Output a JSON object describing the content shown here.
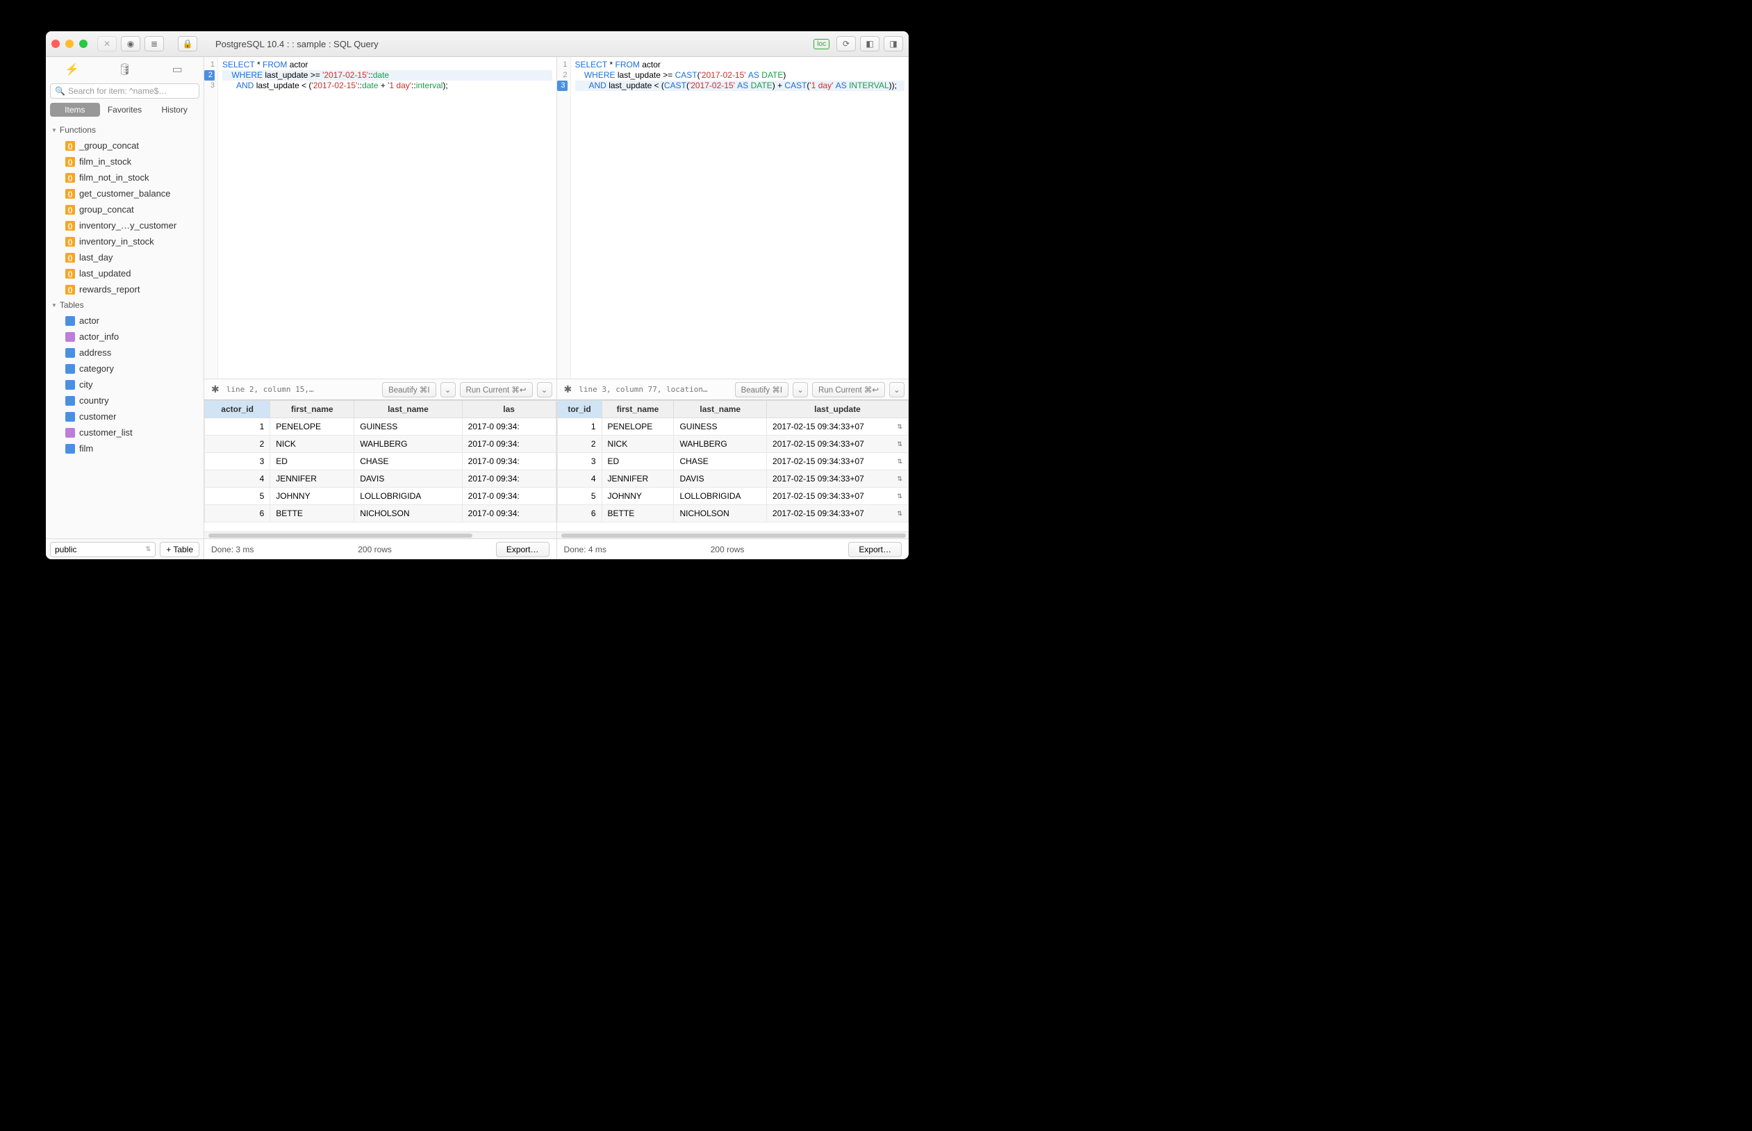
{
  "titlebar": {
    "title": "PostgreSQL 10.4 :  : sample : SQL Query",
    "loc_badge": "loc"
  },
  "sidebar": {
    "search_placeholder": "Search for item: ^name$…",
    "tabs": [
      "Items",
      "Favorites",
      "History"
    ],
    "active_tab": 0,
    "groups": [
      {
        "name": "Functions",
        "type": "fn",
        "items": [
          "_group_concat",
          "film_in_stock",
          "film_not_in_stock",
          "get_customer_balance",
          "group_concat",
          "inventory_…y_customer",
          "inventory_in_stock",
          "last_day",
          "last_updated",
          "rewards_report"
        ]
      },
      {
        "name": "Tables",
        "type": "tbl",
        "items": [
          {
            "label": "actor",
            "kind": "tbl"
          },
          {
            "label": "actor_info",
            "kind": "view"
          },
          {
            "label": "address",
            "kind": "tbl"
          },
          {
            "label": "category",
            "kind": "tbl"
          },
          {
            "label": "city",
            "kind": "tbl"
          },
          {
            "label": "country",
            "kind": "tbl"
          },
          {
            "label": "customer",
            "kind": "tbl"
          },
          {
            "label": "customer_list",
            "kind": "view"
          },
          {
            "label": "film",
            "kind": "tbl"
          }
        ]
      }
    ],
    "schema": "public",
    "add_table_label": "+ Table"
  },
  "panes": [
    {
      "gutter": [
        1,
        2,
        3
      ],
      "hl_lines": [
        2
      ],
      "code_html": "<div class='line'><span class='kw'>SELECT</span> * <span class='kw'>FROM</span> actor</div><div class='line hl'>    <span class='kw'>WHERE</span> last_update &gt;= <span class='str'>'2017-02-15'</span>::<span class='type'>date</span></div><div class='line'>      <span class='kw'>AND</span> last_update &lt; (<span class='str'>'2017-02-15'</span>::<span class='type'>date</span> + <span class='str'>'1 day'</span>::<span class='type'>interval</span>);</div>",
      "status": "line 2, column 15,…",
      "beautify": "Beautify ⌘I",
      "run": "Run Current ⌘↩",
      "columns": [
        "actor_id",
        "first_name",
        "last_name",
        "las"
      ],
      "sorted_col": 0,
      "rows": [
        [
          "1",
          "PENELOPE",
          "GUINESS",
          "2017-0\n09:34:"
        ],
        [
          "2",
          "NICK",
          "WAHLBERG",
          "2017-0\n09:34:"
        ],
        [
          "3",
          "ED",
          "CHASE",
          "2017-0\n09:34:"
        ],
        [
          "4",
          "JENNIFER",
          "DAVIS",
          "2017-0\n09:34:"
        ],
        [
          "5",
          "JOHNNY",
          "LOLLOBRIGIDA",
          "2017-0\n09:34:"
        ],
        [
          "6",
          "BETTE",
          "NICHOLSON",
          "2017-0\n09:34:"
        ]
      ],
      "scroll_w": "75%",
      "done": "Done: 3 ms",
      "rows_label": "200 rows",
      "export": "Export…"
    },
    {
      "gutter": [
        1,
        2,
        3
      ],
      "hl_lines": [
        3
      ],
      "code_html": "<div class='line'><span class='kw'>SELECT</span> * <span class='kw'>FROM</span> actor</div><div class='line'>    <span class='kw'>WHERE</span> last_update &gt;= <span class='kw'>CAST</span>(<span class='str'>'2017-02-15'</span> <span class='kw'>AS</span> <span class='type'>DATE</span>)</div><div class='line hl'>      <span class='kw'>AND</span> last_update &lt; (<span class='kw'>CAST</span>(<span class='str'>'2017-02-15'</span> <span class='kw'>AS</span> <span class='type'>DATE</span>) + <span class='kw'>CAST</span>(<span class='str'>'1 day'</span> <span class='kw'>AS</span> <span class='type'>INTERVAL</span>));</div>",
      "status": "line 3, column 77, location…",
      "beautify": "Beautify ⌘I",
      "run": "Run Current ⌘↩",
      "columns": [
        "tor_id",
        "first_name",
        "last_name",
        "last_update"
      ],
      "sorted_col": 0,
      "rows": [
        [
          "1",
          "PENELOPE",
          "GUINESS",
          "2017-02-15 09:34:33+07"
        ],
        [
          "2",
          "NICK",
          "WAHLBERG",
          "2017-02-15 09:34:33+07"
        ],
        [
          "3",
          "ED",
          "CHASE",
          "2017-02-15 09:34:33+07"
        ],
        [
          "4",
          "JENNIFER",
          "DAVIS",
          "2017-02-15 09:34:33+07"
        ],
        [
          "5",
          "JOHNNY",
          "LOLLOBRIGIDA",
          "2017-02-15 09:34:33+07"
        ],
        [
          "6",
          "BETTE",
          "NICHOLSON",
          "2017-02-15 09:34:33+07"
        ]
      ],
      "scroll_w": "98%",
      "done": "Done: 4 ms",
      "rows_label": "200 rows",
      "export": "Export…"
    }
  ]
}
